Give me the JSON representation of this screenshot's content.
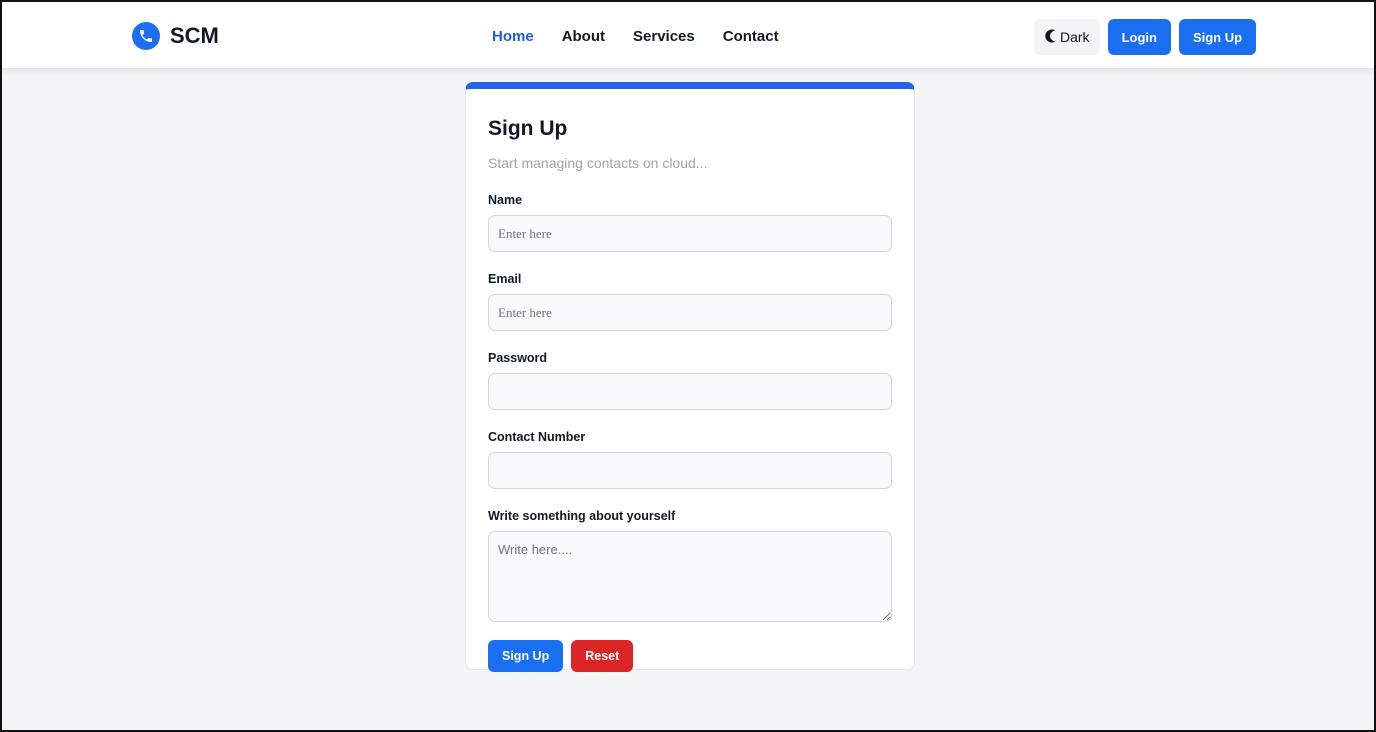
{
  "navbar": {
    "brand": {
      "name": "SCM",
      "icon": "phone-icon",
      "icon_color": "#1a6ff0"
    },
    "links": [
      {
        "label": "Home",
        "active": true
      },
      {
        "label": "About",
        "active": false
      },
      {
        "label": "Services",
        "active": false
      },
      {
        "label": "Contact",
        "active": false
      }
    ],
    "theme_toggle": {
      "label": "Dark",
      "icon": "moon-icon"
    },
    "login_label": "Login",
    "signup_label": "Sign Up"
  },
  "form": {
    "title": "Sign Up",
    "subtitle": "Start managing contacts on cloud...",
    "fields": {
      "name": {
        "label": "Name",
        "placeholder": "Enter here",
        "value": ""
      },
      "email": {
        "label": "Email",
        "placeholder": "Enter here",
        "value": ""
      },
      "password": {
        "label": "Password",
        "placeholder": "",
        "value": ""
      },
      "contact": {
        "label": "Contact Number",
        "placeholder": "",
        "value": ""
      },
      "about": {
        "label": "Write something about yourself",
        "placeholder": "Write here....",
        "value": ""
      }
    },
    "submit_label": "Sign Up",
    "reset_label": "Reset"
  },
  "colors": {
    "accent": "#1a6ff0",
    "card_top_border": "#2563eb",
    "reset": "#dc2626",
    "active_link": "#1d5fd6",
    "page_bg": "#f3f4f6"
  }
}
